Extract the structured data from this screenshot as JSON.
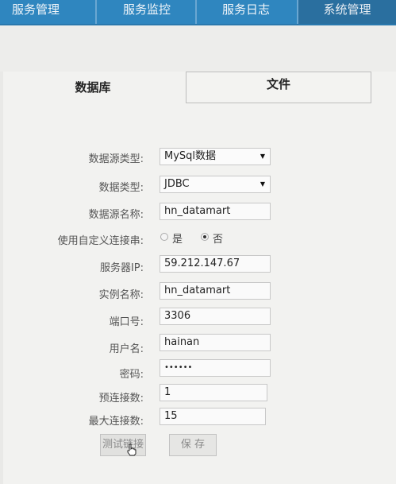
{
  "nav": {
    "tabs": [
      {
        "label": "服务管理"
      },
      {
        "label": "服务监控"
      },
      {
        "label": "服务日志"
      },
      {
        "label": "系统管理"
      }
    ],
    "active_index": 3
  },
  "config": {
    "tabs": {
      "database": "数据库",
      "file": "文件"
    },
    "form": {
      "source_type": {
        "label": "数据源类型:",
        "value": "MySql数据"
      },
      "data_type": {
        "label": "数据类型:",
        "value": "JDBC"
      },
      "source_name": {
        "label": "数据源名称:",
        "value": "hn_datamart"
      },
      "custom_conn": {
        "label": "使用自定义连接串:",
        "option_yes": "是",
        "option_no": "否",
        "selected": "否"
      },
      "server_ip": {
        "label": "服务器IP:",
        "value": "59.212.147.67"
      },
      "instance_name": {
        "label": "实例名称:",
        "value": "hn_datamart"
      },
      "port": {
        "label": "端口号:",
        "value": "3306"
      },
      "username": {
        "label": "用户名:",
        "value": "hainan"
      },
      "password": {
        "label": "密码:",
        "value": "••••••"
      },
      "init_conn": {
        "label": "预连接数:",
        "value": "1"
      },
      "max_conn": {
        "label": "最大连接数:",
        "value": "15"
      }
    },
    "buttons": {
      "test": "测试链接",
      "save": "保 存"
    }
  }
}
